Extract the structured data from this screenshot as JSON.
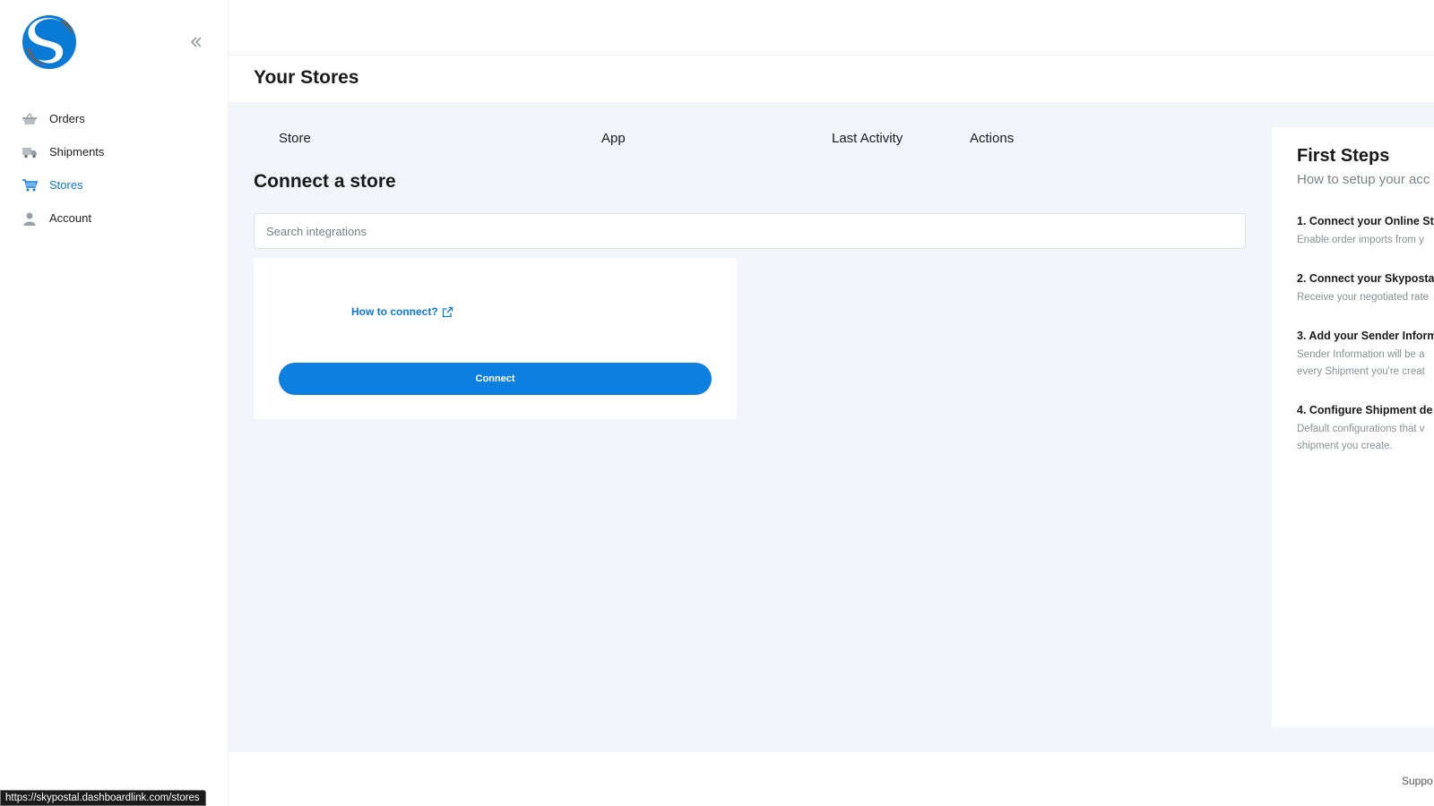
{
  "brand": {
    "primary": "#0c7fe0",
    "logo_color": "#0a7ad7",
    "logo_shadow": "#5f6368"
  },
  "sidebar": {
    "items": [
      {
        "label": "Orders",
        "icon": "basket-icon",
        "active": false
      },
      {
        "label": "Shipments",
        "icon": "truck-icon",
        "active": false
      },
      {
        "label": "Stores",
        "icon": "cart-icon",
        "active": true
      },
      {
        "label": "Account",
        "icon": "user-icon",
        "active": false
      }
    ]
  },
  "header": {
    "title": "Your Stores"
  },
  "table": {
    "columns": [
      "Store",
      "App",
      "Last Activity",
      "Actions"
    ]
  },
  "connect": {
    "title": "Connect a store",
    "search_placeholder": "Search integrations",
    "how_to_label": "How to connect?",
    "button_label": "Connect"
  },
  "first_steps": {
    "title": "First Steps",
    "subtitle": "How to setup your acc",
    "steps": [
      {
        "title": "1. Connect your Online St",
        "desc": [
          "Enable order imports from y"
        ]
      },
      {
        "title": "2. Connect your Skyposta",
        "desc": [
          "Receive your negotiated rate"
        ]
      },
      {
        "title": "3. Add your Sender Inform",
        "desc": [
          "Sender Information will be a",
          "every Shipment you're creat"
        ]
      },
      {
        "title": "4. Configure Shipment de",
        "desc": [
          "Default configurations that v",
          "shipment you create."
        ]
      }
    ]
  },
  "footer": {
    "support_label": "Suppo"
  },
  "status_bar": {
    "url": "https://skypostal.dashboardlink.com/stores"
  }
}
